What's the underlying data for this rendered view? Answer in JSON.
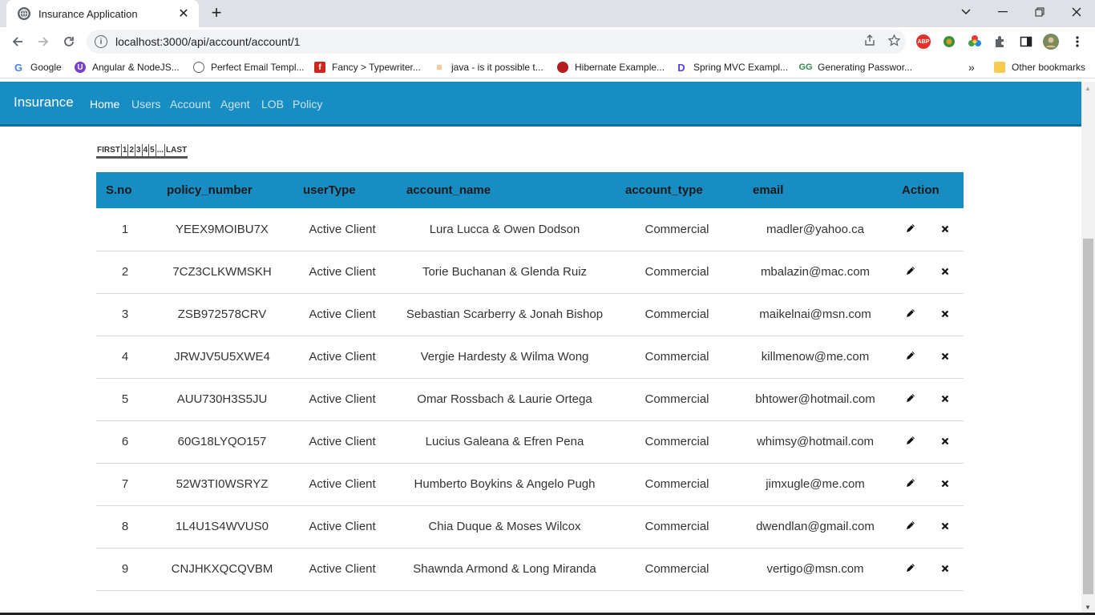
{
  "browser": {
    "tab_title": "Insurance Application",
    "tab_close": "✕",
    "new_tab": "+",
    "url": "localhost:3000/api/account/account/1",
    "bookmarks": [
      {
        "label": "Google"
      },
      {
        "label": "Angular & NodeJS..."
      },
      {
        "label": "Perfect Email Templ..."
      },
      {
        "label": "Fancy > Typewriter..."
      },
      {
        "label": "java - is it possible t..."
      },
      {
        "label": "Hibernate Example..."
      },
      {
        "label": "Spring MVC Exampl..."
      },
      {
        "label": "Generating Passwor..."
      }
    ],
    "bookmarks_overflow": "»",
    "other_bookmarks": "Other bookmarks",
    "extensions": {
      "abp": "ABP"
    }
  },
  "app": {
    "brand": "Insurance",
    "nav": [
      "Home",
      "Users",
      "Account",
      "Agent",
      "LOB",
      "Policy"
    ],
    "active_nav": "Home"
  },
  "pagination": [
    "FIRST",
    "1",
    "2",
    "3",
    "4",
    "5",
    "...",
    "LAST"
  ],
  "table": {
    "columns": [
      "S.no",
      "policy_number",
      "userType",
      "account_name",
      "account_type",
      "email",
      "Action"
    ],
    "rows": [
      [
        "1",
        "YEEX9MOIBU7X",
        "Active Client",
        "Lura Lucca & Owen Dodson",
        "Commercial",
        "madler@yahoo.ca"
      ],
      [
        "2",
        "7CZ3CLKWMSKH",
        "Active Client",
        "Torie Buchanan & Glenda Ruiz",
        "Commercial",
        "mbalazin@mac.com"
      ],
      [
        "3",
        "ZSB972578CRV",
        "Active Client",
        "Sebastian Scarberry & Jonah Bishop",
        "Commercial",
        "maikelnai@msn.com"
      ],
      [
        "4",
        "JRWJV5U5XWE4",
        "Active Client",
        "Vergie Hardesty & Wilma Wong",
        "Commercial",
        "killmenow@me.com"
      ],
      [
        "5",
        "AUU730H3S5JU",
        "Active Client",
        "Omar Rossbach & Laurie Ortega",
        "Commercial",
        "bhtower@hotmail.com"
      ],
      [
        "6",
        "60G18LYQO157",
        "Active Client",
        "Lucius Galeana & Efren Pena",
        "Commercial",
        "whimsy@hotmail.com"
      ],
      [
        "7",
        "52W3TI0WSRYZ",
        "Active Client",
        "Humberto Boykins & Angelo Pugh",
        "Commercial",
        "jimxugle@me.com"
      ],
      [
        "8",
        "1L4U1S4WVUS0",
        "Active Client",
        "Chia Duque & Moses Wilcox",
        "Commercial",
        "dwendlan@gmail.com"
      ],
      [
        "9",
        "CNJHKXQCQVBM",
        "Active Client",
        "Shawnda Armond & Long Miranda",
        "Commercial",
        "vertigo@msn.com"
      ]
    ],
    "action_icons": [
      "pencil-icon",
      "x-mark-icon"
    ]
  },
  "colors": {
    "navbar": "#188dc4",
    "header_row": "#188dc4"
  }
}
